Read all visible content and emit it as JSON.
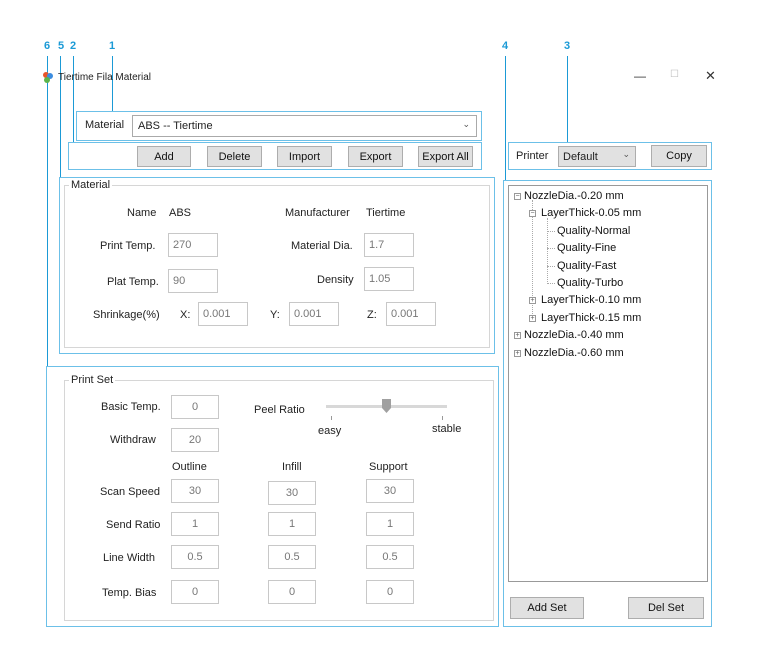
{
  "callouts": [
    "6",
    "5",
    "2",
    "1",
    "4",
    "3"
  ],
  "window": {
    "title": "Tiertime Fila Material",
    "minimize": "—",
    "maximize": "☐",
    "close": "✕"
  },
  "material_select": {
    "label": "Material",
    "value": "ABS -- Tiertime"
  },
  "toolbar": {
    "add": "Add",
    "delete": "Delete",
    "import": "Import",
    "export": "Export",
    "export_all": "Export All"
  },
  "material": {
    "title": "Material",
    "name_label": "Name",
    "name_value": "ABS",
    "manufacturer_label": "Manufacturer",
    "manufacturer_value": "Tiertime",
    "print_temp_label": "Print Temp.",
    "print_temp": "270",
    "material_dia_label": "Material Dia.",
    "material_dia": "1.7",
    "plat_temp_label": "Plat Temp.",
    "plat_temp": "90",
    "density_label": "Density",
    "density": "1.05",
    "shrinkage_label": "Shrinkage(%)",
    "x_label": "X:",
    "x": "0.001",
    "y_label": "Y:",
    "y": "0.001",
    "z_label": "Z:",
    "z": "0.001"
  },
  "print_set": {
    "title": "Print Set",
    "basic_temp_label": "Basic Temp.",
    "basic_temp": "0",
    "withdraw_label": "Withdraw",
    "withdraw": "20",
    "peel_ratio_label": "Peel Ratio",
    "peel_easy": "easy",
    "peel_stable": "stable",
    "peel_ratio_value": 0.5,
    "col_outline": "Outline",
    "col_infill": "Infill",
    "col_support": "Support",
    "rows": [
      {
        "label": "Scan Speed",
        "outline": "30",
        "infill": "30",
        "support": "30"
      },
      {
        "label": "Send Ratio",
        "outline": "1",
        "infill": "1",
        "support": "1"
      },
      {
        "label": "Line Width",
        "outline": "0.5",
        "infill": "0.5",
        "support": "0.5"
      },
      {
        "label": "Temp. Bias",
        "outline": "0",
        "infill": "0",
        "support": "0"
      }
    ]
  },
  "printer": {
    "label": "Printer",
    "value": "Default",
    "copy": "Copy"
  },
  "tree": {
    "n1": "NozzleDia.-0.20 mm",
    "l1": "LayerThick-0.05 mm",
    "q1": "Quality-Normal",
    "q2": "Quality-Fine",
    "q3": "Quality-Fast",
    "q4": "Quality-Turbo",
    "l2": "LayerThick-0.10 mm",
    "l3": "LayerThick-0.15 mm",
    "n2": "NozzleDia.-0.40 mm",
    "n3": "NozzleDia.-0.60 mm"
  },
  "set_buttons": {
    "add_set": "Add Set",
    "del_set": "Del Set"
  }
}
